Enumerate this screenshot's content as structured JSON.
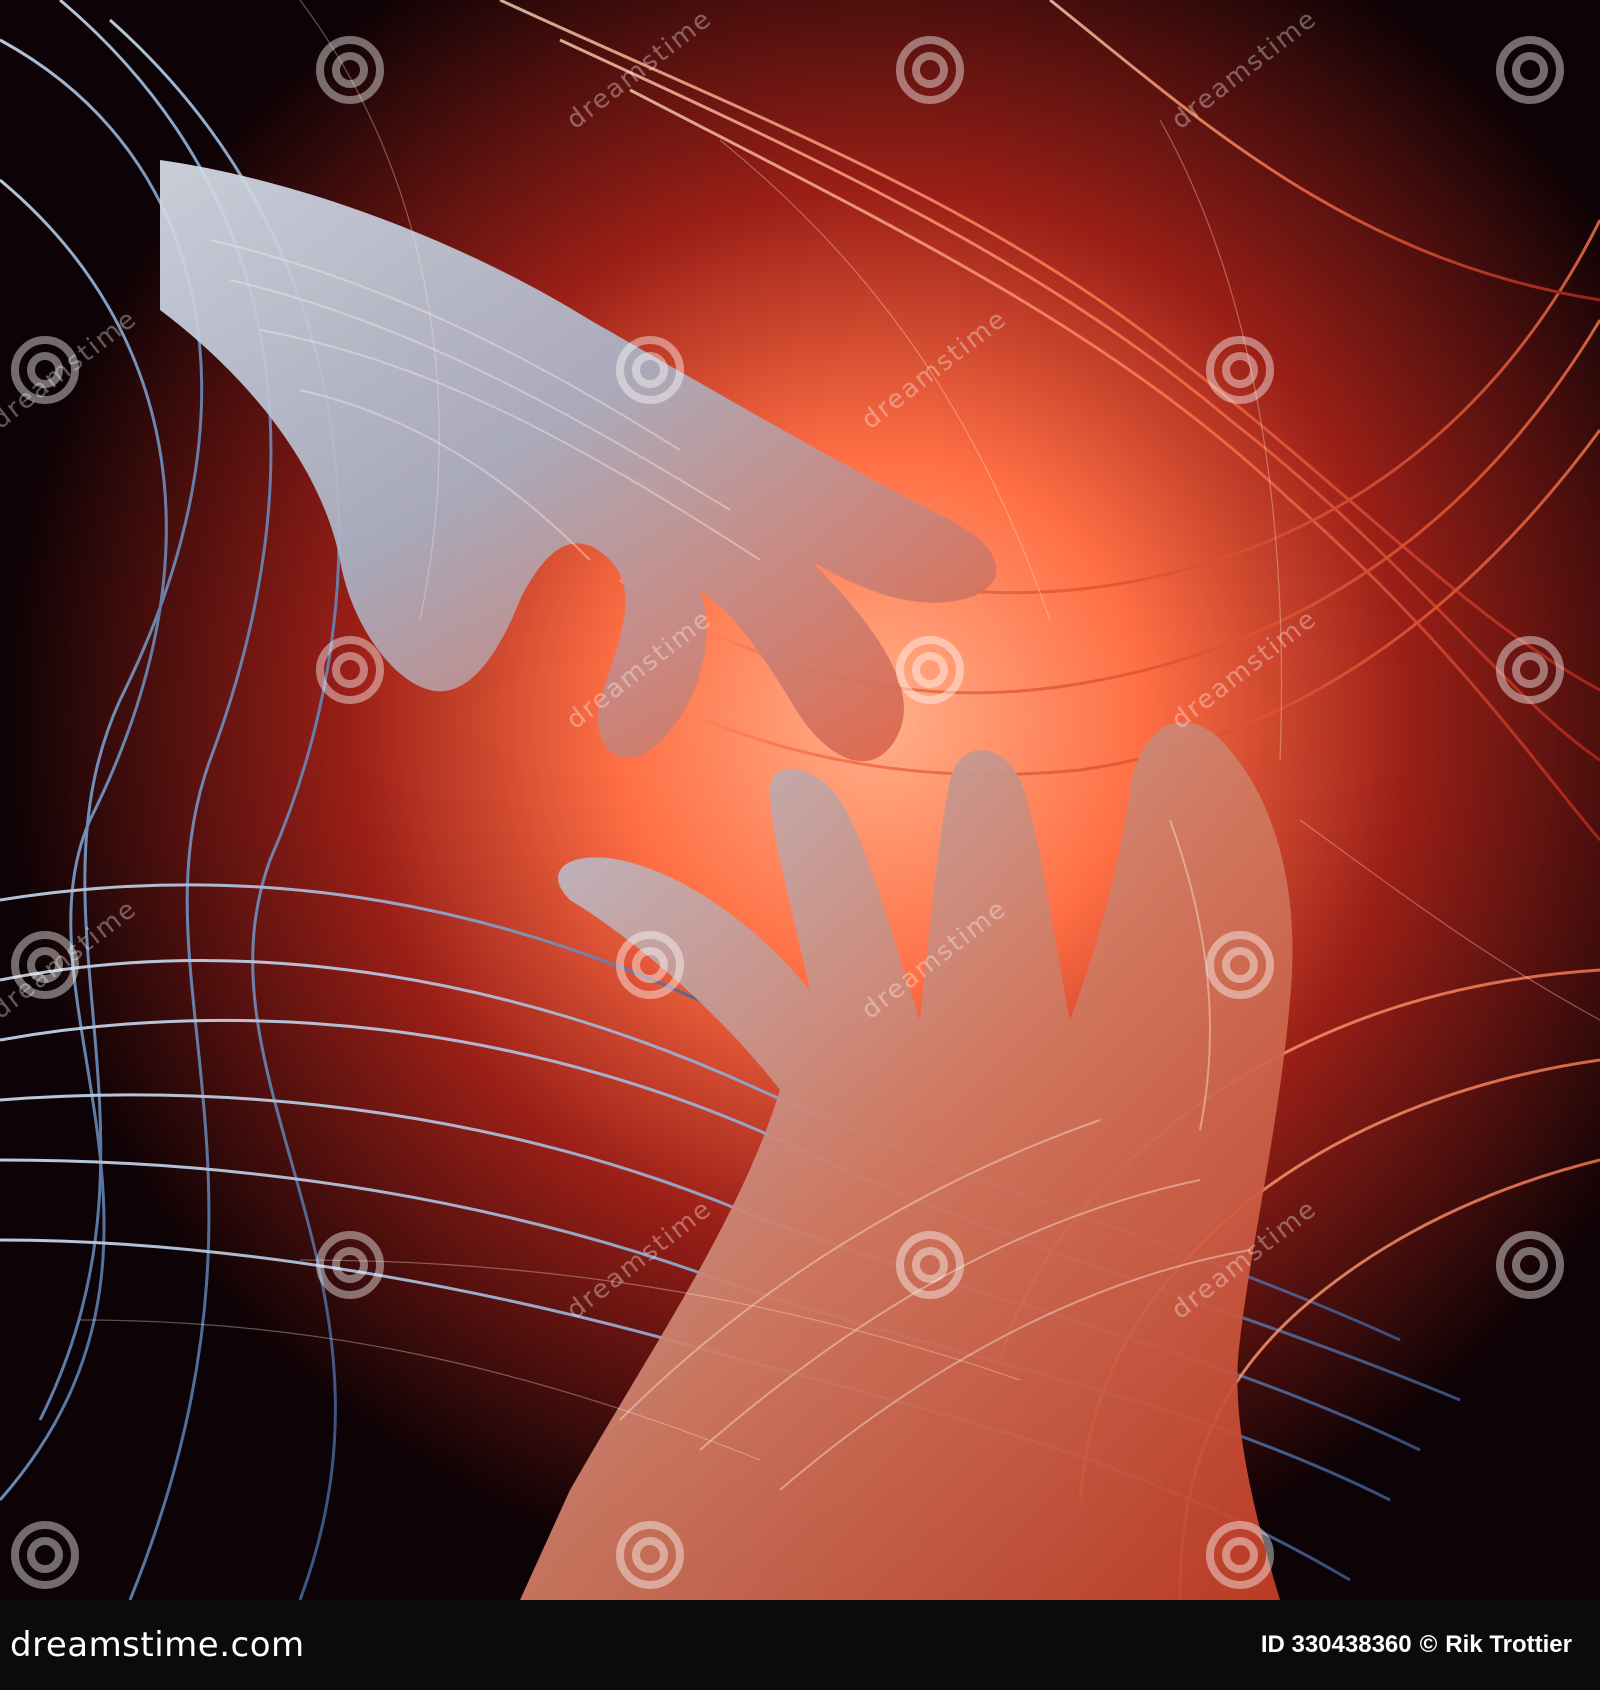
{
  "footer": {
    "brand_text": "dreamstime.com",
    "id_text": "ID 330438360",
    "copyright_symbol": "©",
    "author_name": "Rik Trottier"
  },
  "watermark": {
    "text": "dreamstime",
    "icon": "swirl-logo-icon"
  },
  "colors": {
    "background": "#120406",
    "glow": "#ff8a5c",
    "red": "#d9432a",
    "blue_strands": "#9fc6e8",
    "footer": "#0b0b0c"
  },
  "image": {
    "subject": "two hands reaching toward each other, formed from glowing fibers"
  }
}
